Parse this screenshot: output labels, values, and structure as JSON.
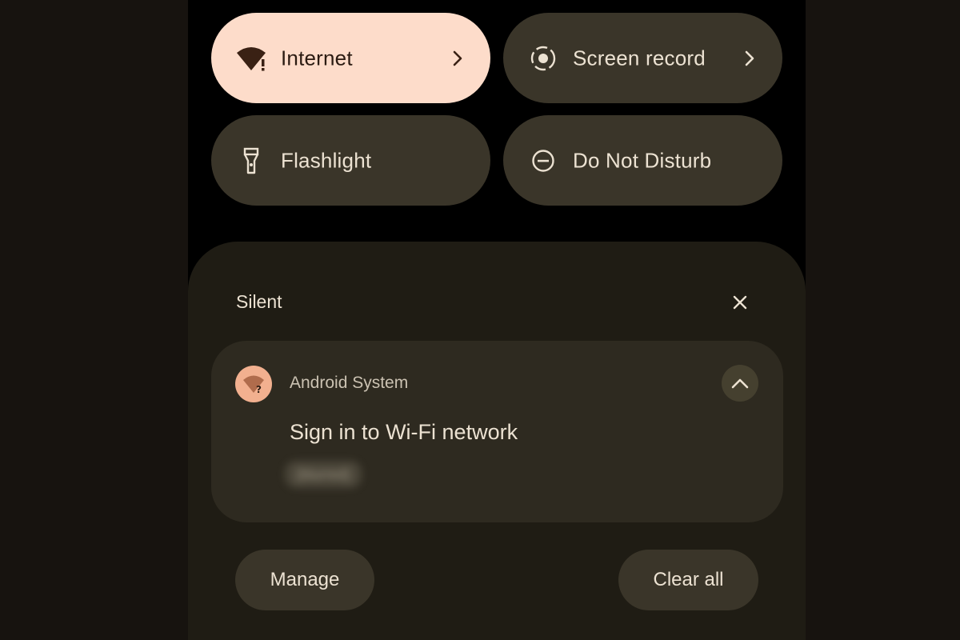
{
  "quick_settings": {
    "internet": {
      "label": "Internet",
      "icon": "wifi-alert-icon"
    },
    "screen_record": {
      "label": "Screen record",
      "icon": "screen-record-icon"
    },
    "flashlight": {
      "label": "Flashlight",
      "icon": "flashlight-icon"
    },
    "dnd": {
      "label": "Do Not Disturb",
      "icon": "do-not-disturb-icon"
    }
  },
  "notifications": {
    "section_label": "Silent",
    "item": {
      "app_name": "Android System",
      "title": "Sign in to Wi-Fi network",
      "subtitle": "(blurred)"
    },
    "manage_label": "Manage",
    "clear_all_label": "Clear all"
  },
  "colors": {
    "active_tile": "#fddcca",
    "inactive_tile": "#3a3529",
    "panel": "#1f1c14",
    "notification_card": "#2e2a20",
    "text": "#ece2d2"
  }
}
